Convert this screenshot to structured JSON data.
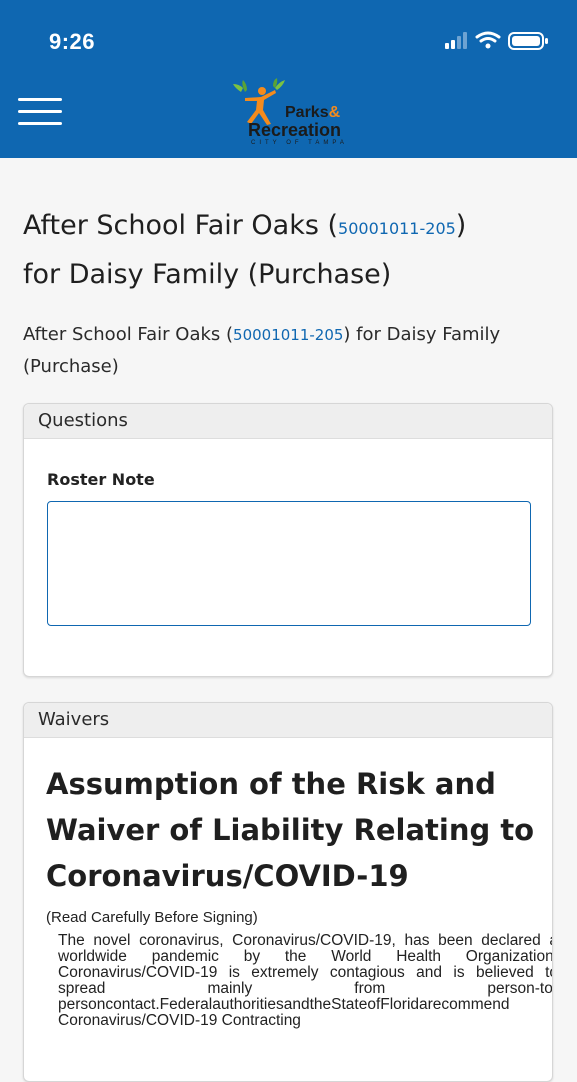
{
  "status_bar": {
    "time": "9:26"
  },
  "header": {
    "logo": {
      "line1": "Parks",
      "line1_amp": "&",
      "line2": "Recreation",
      "sub": "CITY OF TAMPA"
    },
    "colors": {
      "brand": "#0f67b1",
      "logo_accent": "#f48b1d"
    }
  },
  "page": {
    "title_prefix": "After School Fair Oaks (",
    "title_code": "50001011-205",
    "title_suffix_paren": ")",
    "title_line2": "for Daisy Family (Purchase)",
    "subtitle_prefix": "After School Fair Oaks (",
    "subtitle_code": "50001011-205",
    "subtitle_suffix": ") for Daisy Family (Purchase)"
  },
  "questions": {
    "header": "Questions",
    "roster_note_label": "Roster Note",
    "roster_note_value": ""
  },
  "waivers": {
    "header": "Waivers",
    "title": "Assumption of the Risk and Waiver of Liability Relating to Coronavirus/COVID-19",
    "note": "(Read Carefully Before Signing)",
    "body": "The novel coronavirus, Coronavirus/COVID-19, has been declared a worldwide pandemic by the World Health Organization. Coronavirus/COVID-19 is extremely contagious and is believed to spread mainly from person-to-personcontact.FederalauthoritiesandtheStateofFloridarecommend Coronavirus/COVID-19 Contracting"
  }
}
